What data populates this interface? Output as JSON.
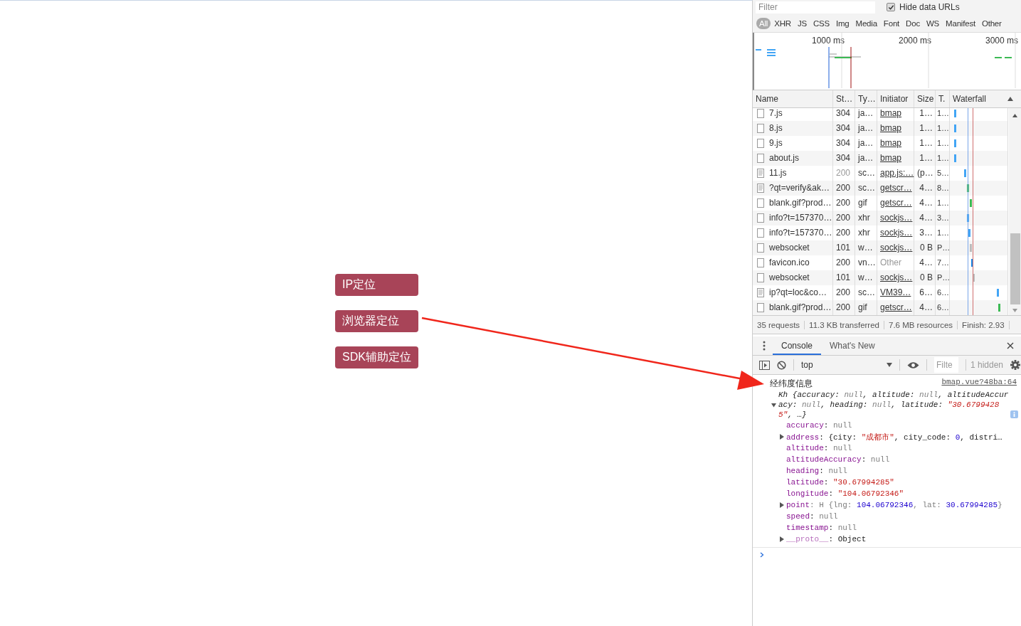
{
  "page": {
    "buttons": [
      {
        "label": "IP定位"
      },
      {
        "label": "浏览器定位"
      },
      {
        "label": "SDK辅助定位"
      }
    ]
  },
  "devtools": {
    "network": {
      "filter": {
        "placeholder": "Filter"
      },
      "hide_data_urls": {
        "label": "Hide data URLs",
        "checked": true
      },
      "types": [
        {
          "label": "All",
          "selected": true
        },
        {
          "label": "XHR",
          "selected": false
        },
        {
          "label": "JS",
          "selected": false
        },
        {
          "label": "CSS",
          "selected": false
        },
        {
          "label": "Img",
          "selected": false
        },
        {
          "label": "Media",
          "selected": false
        },
        {
          "label": "Font",
          "selected": false
        },
        {
          "label": "Doc",
          "selected": false
        },
        {
          "label": "WS",
          "selected": false
        },
        {
          "label": "Manifest",
          "selected": false
        },
        {
          "label": "Other",
          "selected": false
        }
      ],
      "overview_ticks": [
        "1000 ms",
        "2000 ms",
        "3000 ms"
      ],
      "columns": [
        "Name",
        "St…",
        "Ty…",
        "Initiator",
        "Size",
        "T.",
        "Waterfall"
      ],
      "rows": [
        {
          "kind": "plain",
          "name": "7.js",
          "status": "304",
          "type": "ja…",
          "initiator": "bmap",
          "initiator_link": true,
          "size": "1…",
          "time": "1…",
          "dimmed": false,
          "color": "#42a5f5"
        },
        {
          "kind": "plain",
          "name": "8.js",
          "status": "304",
          "type": "ja…",
          "initiator": "bmap",
          "initiator_link": true,
          "size": "1…",
          "time": "1…",
          "dimmed": false,
          "color": "#42a5f5"
        },
        {
          "kind": "plain",
          "name": "9.js",
          "status": "304",
          "type": "ja…",
          "initiator": "bmap",
          "initiator_link": true,
          "size": "1…",
          "time": "1…",
          "dimmed": false,
          "color": "#42a5f5"
        },
        {
          "kind": "plain",
          "name": "about.js",
          "status": "304",
          "type": "ja…",
          "initiator": "bmap",
          "initiator_link": true,
          "size": "1…",
          "time": "1…",
          "dimmed": false,
          "color": "#42a5f5"
        },
        {
          "kind": "script",
          "name": "11.js",
          "status": "200",
          "type": "sc…",
          "initiator": "app.js:…",
          "initiator_link": true,
          "size": "(p…",
          "time": "5…",
          "dimmed": true,
          "color": "#42a5f5"
        },
        {
          "kind": "script",
          "name": "?qt=verify&ak…",
          "status": "200",
          "type": "sc…",
          "initiator": "getscr…",
          "initiator_link": true,
          "size": "4…",
          "time": "8…",
          "dimmed": false,
          "color": "#3cba54"
        },
        {
          "kind": "plain",
          "name": "blank.gif?prod…",
          "status": "200",
          "type": "gif",
          "initiator": "getscr…",
          "initiator_link": true,
          "size": "4…",
          "time": "1…",
          "dimmed": false,
          "color": "#3cba54"
        },
        {
          "kind": "plain",
          "name": "info?t=157370…",
          "status": "200",
          "type": "xhr",
          "initiator": "sockjs…",
          "initiator_link": true,
          "size": "4…",
          "time": "3…",
          "dimmed": false,
          "color": "#42a5f5"
        },
        {
          "kind": "plain",
          "name": "info?t=157370…",
          "status": "200",
          "type": "xhr",
          "initiator": "sockjs…",
          "initiator_link": true,
          "size": "3…",
          "time": "1…",
          "dimmed": false,
          "color": "#42a5f5"
        },
        {
          "kind": "plain",
          "name": "websocket",
          "status": "101",
          "type": "w…",
          "initiator": "sockjs…",
          "initiator_link": true,
          "size": "0 B",
          "time": "P…",
          "dimmed": false,
          "color": "#bbbbbb"
        },
        {
          "kind": "plain",
          "name": "favicon.ico",
          "status": "200",
          "type": "vn…",
          "initiator": "Other",
          "initiator_link": false,
          "size": "4…",
          "time": "7…",
          "dimmed": false,
          "color": "#1e88e5"
        },
        {
          "kind": "plain",
          "name": "websocket",
          "status": "101",
          "type": "w…",
          "initiator": "sockjs…",
          "initiator_link": true,
          "size": "0 B",
          "time": "P…",
          "dimmed": false,
          "color": "#bbbbbb"
        },
        {
          "kind": "script",
          "name": "ip?qt=loc&co…",
          "status": "200",
          "type": "sc…",
          "initiator": "VM39…",
          "initiator_link": true,
          "size": "6…",
          "time": "6…",
          "dimmed": false,
          "color": "#42a5f5"
        },
        {
          "kind": "plain",
          "name": "blank.gif?prod…",
          "status": "200",
          "type": "gif",
          "initiator": "getscr…",
          "initiator_link": true,
          "size": "4…",
          "time": "6…",
          "dimmed": false,
          "color": "#3cba54"
        }
      ],
      "summary": [
        "35 requests",
        "11.3 KB transferred",
        "7.6 MB resources",
        "Finish: 2.93"
      ]
    },
    "drawer_tabs": [
      {
        "label": "Console",
        "selected": true
      },
      {
        "label": "What's New",
        "selected": false
      }
    ],
    "console_toolbar": {
      "context": "top",
      "filter": {
        "placeholder": "Filte"
      },
      "hidden": "1 hidden"
    },
    "console": {
      "message": "经纬度信息",
      "source": "bmap.vue?48ba:64",
      "summary": [
        {
          "text": "Kh {accuracy: ",
          "kind": "plain"
        },
        {
          "text": "null",
          "kind": "null"
        },
        {
          "text": ", altitude: ",
          "kind": "plain"
        },
        {
          "text": "null",
          "kind": "null"
        },
        {
          "text": ", altitudeAccuracy: ",
          "kind": "plain"
        },
        {
          "text": "null",
          "kind": "null"
        },
        {
          "text": ", heading: ",
          "kind": "plain"
        },
        {
          "text": "null",
          "kind": "null"
        },
        {
          "text": ", latitude: ",
          "kind": "plain"
        },
        {
          "text": "\"30.67994285\"",
          "kind": "string"
        },
        {
          "text": ", …}",
          "kind": "plain"
        }
      ],
      "expanded": true,
      "properties": [
        {
          "key": "accuracy",
          "expandable": false,
          "value": [
            {
              "text": ": ",
              "kind": "plain"
            },
            {
              "text": "null",
              "kind": "null"
            }
          ]
        },
        {
          "key": "address",
          "expandable": true,
          "value": [
            {
              "text": ": {city: ",
              "kind": "plain"
            },
            {
              "text": "\"成都市\"",
              "kind": "string"
            },
            {
              "text": ", city_code: ",
              "kind": "plain"
            },
            {
              "text": "0",
              "kind": "number"
            },
            {
              "text": ", distri…",
              "kind": "plain"
            }
          ]
        },
        {
          "key": "altitude",
          "expandable": false,
          "value": [
            {
              "text": ": ",
              "kind": "plain"
            },
            {
              "text": "null",
              "kind": "null"
            }
          ]
        },
        {
          "key": "altitudeAccuracy",
          "expandable": false,
          "value": [
            {
              "text": ": ",
              "kind": "plain"
            },
            {
              "text": "null",
              "kind": "null"
            }
          ]
        },
        {
          "key": "heading",
          "expandable": false,
          "value": [
            {
              "text": ": ",
              "kind": "plain"
            },
            {
              "text": "null",
              "kind": "null"
            }
          ]
        },
        {
          "key": "latitude",
          "expandable": false,
          "value": [
            {
              "text": ": ",
              "kind": "plain"
            },
            {
              "text": "\"30.67994285\"",
              "kind": "string"
            }
          ]
        },
        {
          "key": "longitude",
          "expandable": false,
          "value": [
            {
              "text": ": ",
              "kind": "plain"
            },
            {
              "text": "\"104.06792346\"",
              "kind": "string"
            }
          ]
        },
        {
          "key": "point",
          "expandable": true,
          "value": [
            {
              "text": ": H {lng: ",
              "kind": "null"
            },
            {
              "text": "104.06792346",
              "kind": "number"
            },
            {
              "text": ", lat: ",
              "kind": "null"
            },
            {
              "text": "30.67994285",
              "kind": "number"
            },
            {
              "text": "}",
              "kind": "null"
            }
          ]
        },
        {
          "key": "speed",
          "expandable": false,
          "value": [
            {
              "text": ": ",
              "kind": "plain"
            },
            {
              "text": "null",
              "kind": "null"
            }
          ]
        },
        {
          "key": "timestamp",
          "expandable": false,
          "value": [
            {
              "text": ": ",
              "kind": "plain"
            },
            {
              "text": "null",
              "kind": "null"
            }
          ]
        },
        {
          "key": "__proto__",
          "expandable": true,
          "dim": true,
          "value": [
            {
              "text": ": ",
              "kind": "plain"
            },
            {
              "text": "Object",
              "kind": "plain"
            }
          ]
        }
      ]
    }
  }
}
